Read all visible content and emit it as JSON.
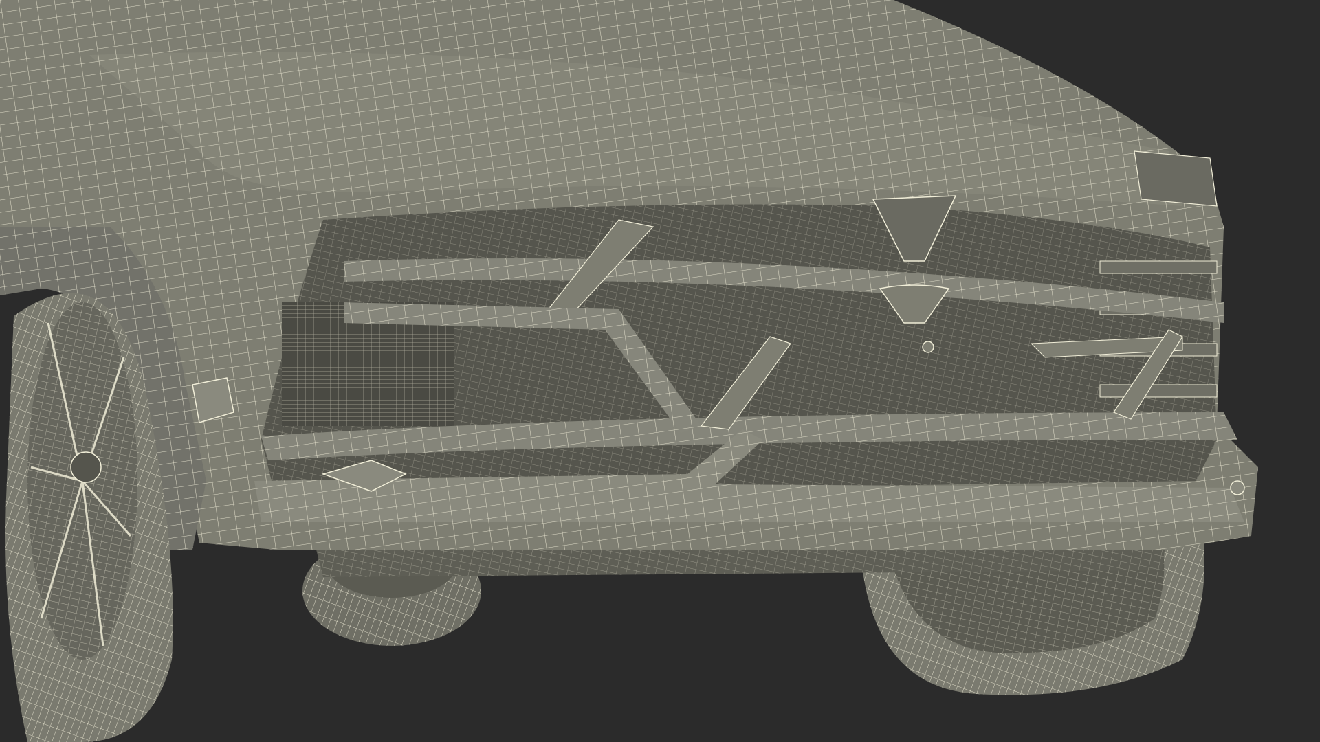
{
  "scene": {
    "background_color": "#2b2b2b",
    "body_color": "#7e7e72",
    "body_shadow_color": "#5b5b52",
    "dark_part_color": "#4a4a43",
    "wire_color": "#f1eed8",
    "render_style": "wireframe-over-shaded"
  }
}
